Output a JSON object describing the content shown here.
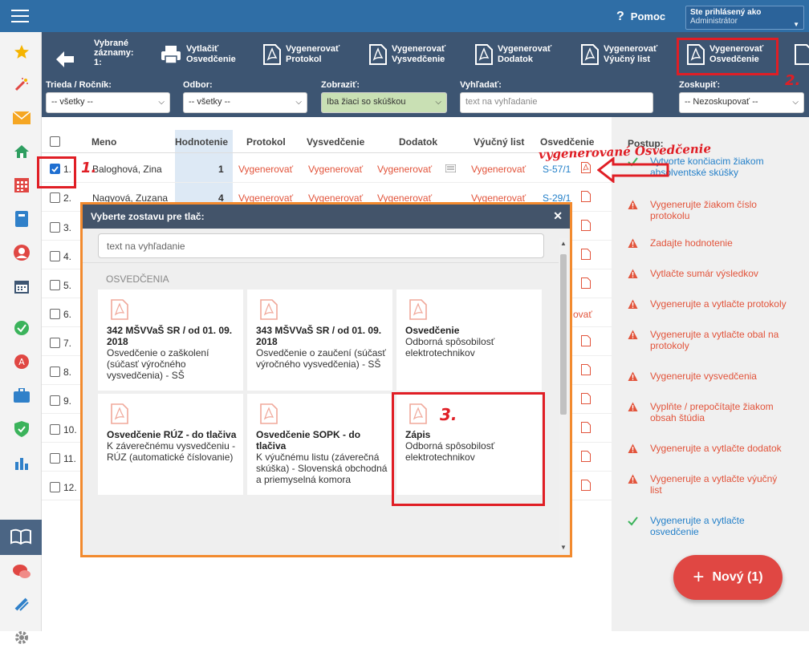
{
  "topbar": {
    "help_label": "Pomoc",
    "user_line1": "Ste prihlásený ako",
    "user_line2": "Administrátor"
  },
  "toolbar": {
    "selected_l1": "Vybrané",
    "selected_l2": "záznamy:",
    "selected_l3": "1:",
    "buttons": [
      {
        "l1": "Vytlačiť",
        "l2": "Osvedčenie",
        "icon": "printer-icon"
      },
      {
        "l1": "Vygenerovať",
        "l2": "Protokol",
        "icon": "pdf-icon"
      },
      {
        "l1": "Vygenerovať",
        "l2": "Vysvedčenie",
        "icon": "pdf-icon"
      },
      {
        "l1": "Vygenerovať",
        "l2": "Dodatok",
        "icon": "pdf-icon"
      },
      {
        "l1": "Vygenerovať",
        "l2": "Výučný list",
        "icon": "pdf-icon"
      },
      {
        "l1": "Vygenerovať",
        "l2": "Osvedčenie",
        "icon": "pdf-icon"
      }
    ]
  },
  "filters": {
    "trieda_label": "Trieda / Ročník:",
    "trieda_value": "-- všetky --",
    "odbor_label": "Odbor:",
    "odbor_value": "-- všetky --",
    "zobrazit_label": "Zobraziť:",
    "zobrazit_value": "Iba žiaci so skúškou",
    "hladat_label": "Vyhľadať:",
    "hladat_placeholder": "text na vyhľadanie",
    "zoskupit_label": "Zoskupiť:",
    "zoskupit_value": "-- Nezoskupovať --"
  },
  "table": {
    "headers": [
      "Meno",
      "Hodnotenie",
      "Protokol",
      "Vysvedčenie",
      "Dodatok",
      "Výučný list",
      "Osvedčenie"
    ],
    "generate_label": "Vygenerovať",
    "rows": [
      {
        "num": "1.",
        "name": "Baloghová, Zina",
        "grade": "1",
        "osvedcenie": "S-57/1",
        "checked": true
      },
      {
        "num": "2.",
        "name": "Nagyová, Zuzana",
        "grade": "4",
        "osvedcenie": "S-29/1",
        "checked": false
      },
      {
        "num": "3."
      },
      {
        "num": "4."
      },
      {
        "num": "5."
      },
      {
        "num": "6."
      },
      {
        "num": "7."
      },
      {
        "num": "8."
      },
      {
        "num": "9."
      },
      {
        "num": "10."
      },
      {
        "num": "11."
      },
      {
        "num": "12."
      }
    ],
    "row6_partial": "ovať"
  },
  "right_panel": {
    "title": "Postup:",
    "steps": [
      {
        "text": "Vytvorte končiacim žiakom absolventské skúšky",
        "status": "done"
      },
      {
        "text": "Vygenerujte žiakom číslo protokolu",
        "status": "warn"
      },
      {
        "text": "Zadajte hodnotenie",
        "status": "warn"
      },
      {
        "text": "Vytlačte sumár výsledkov",
        "status": "warn"
      },
      {
        "text": "Vygenerujte a vytlačte protokoly",
        "status": "warn"
      },
      {
        "text": "Vygenerujte a vytlačte obal na protokoly",
        "status": "warn"
      },
      {
        "text": "Vygenerujte vysvedčenia",
        "status": "warn"
      },
      {
        "text": "Vyplňte / prepočítajte žiakom obsah štúdia",
        "status": "warn"
      },
      {
        "text": "Vygenerujte a vytlačte dodatok",
        "status": "warn"
      },
      {
        "text": "Vygenerujte a vytlačte výučný list",
        "status": "warn"
      },
      {
        "text": "Vygenerujte a vytlačte osvedčenie",
        "status": "done"
      }
    ],
    "new_button": "Nový (1)"
  },
  "modal": {
    "title": "Vyberte zostavu pre tlač:",
    "search_placeholder": "text na vyhľadanie",
    "section": "OSVEDČENIA",
    "cards": [
      {
        "title": "342 MŠVVaŠ SR / od 01. 09. 2018",
        "sub": "Osvedčenie o zaškolení (súčasť výročného vysvedčenia) - SŠ"
      },
      {
        "title": "343 MŠVVaŠ SR / od 01. 09. 2018",
        "sub": "Osvedčenie o zaučení (súčasť výročného vysvedčenia) - SŠ"
      },
      {
        "title": "Osvedčenie",
        "sub": "Odborná spôsobilosť elektrotechnikov"
      },
      {
        "title": "Osvedčenie RÚZ - do tlačiva",
        "sub": "K záverečnému vysvedčeniu - RÚZ (automatické číslovanie)"
      },
      {
        "title": "Osvedčenie SOPK - do tlačiva",
        "sub": "K výučnému listu (záverečná skúška) - Slovenská obchodná a priemyselná komora"
      },
      {
        "title": "Zápis",
        "sub": "Odborná spôsobilosť elektrotechnikov"
      }
    ]
  },
  "annotations": {
    "one": "1.",
    "two": "2.",
    "three": "3.",
    "handwritten": "vygenerované Osvedčenie"
  },
  "colors": {
    "accent_red": "#e2533a",
    "link_blue": "#2480c9",
    "annotation": "#e01e25",
    "modal_border": "#f28a2e"
  }
}
